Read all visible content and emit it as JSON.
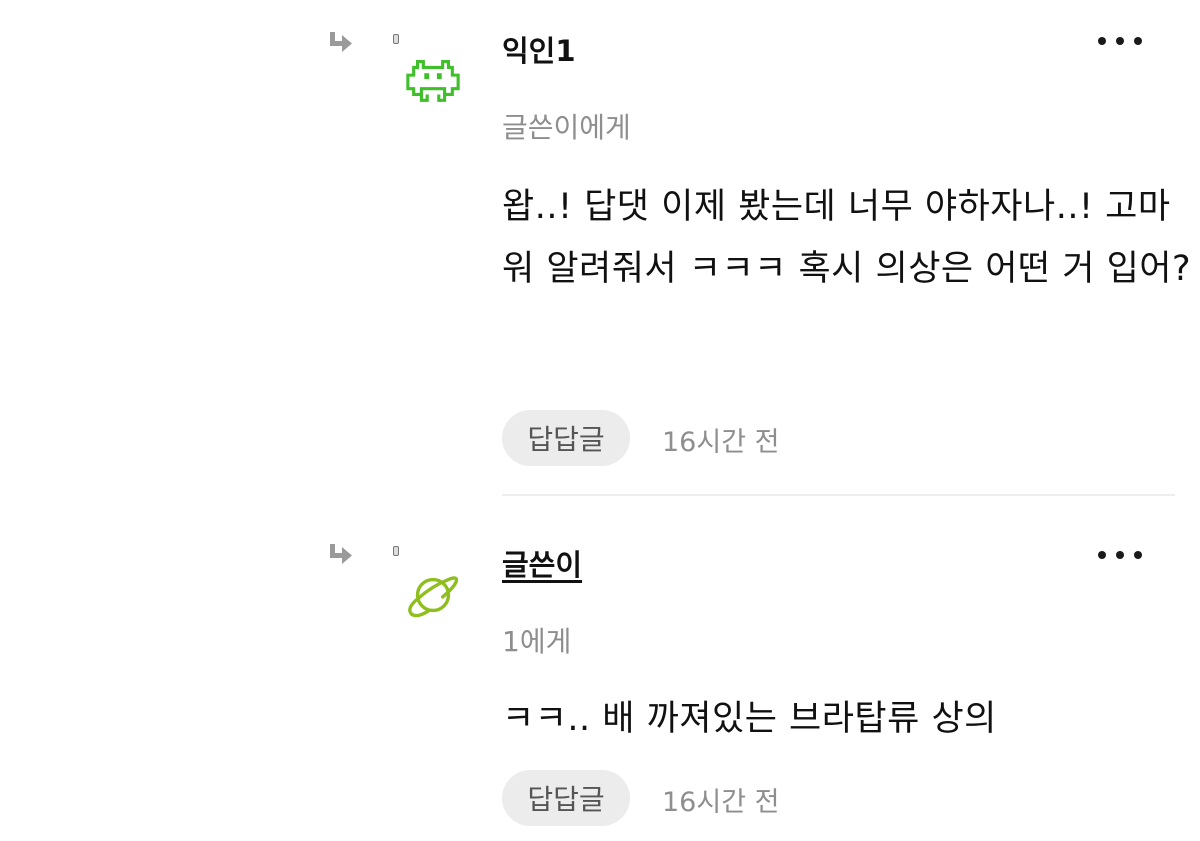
{
  "comments": [
    {
      "author": "익인1",
      "recipient": "글쓴이에게",
      "body": "왑..! 답댓 이제 봤는데 너무 야하자나..! 고마워 알려줘서 ㅋㅋㅋ 혹시 의상은 어떤 거 입어?",
      "reply_label": "답답글",
      "time": "16시간 전",
      "avatar_icon": "pixel-invader-icon",
      "avatar_color": "#3fbf2a"
    },
    {
      "author": "글쓴이",
      "recipient": "1에게",
      "body": "ㅋㅋ.. 배 까져있는 브라탑류 상의",
      "reply_label": "답답글",
      "time": "16시간 전",
      "avatar_icon": "planet-icon",
      "avatar_color": "#8fbf1f"
    }
  ],
  "colors": {
    "muted_text": "#8e8e8e",
    "reply_button_bg": "#ececec",
    "divider": "#eeeeee"
  }
}
